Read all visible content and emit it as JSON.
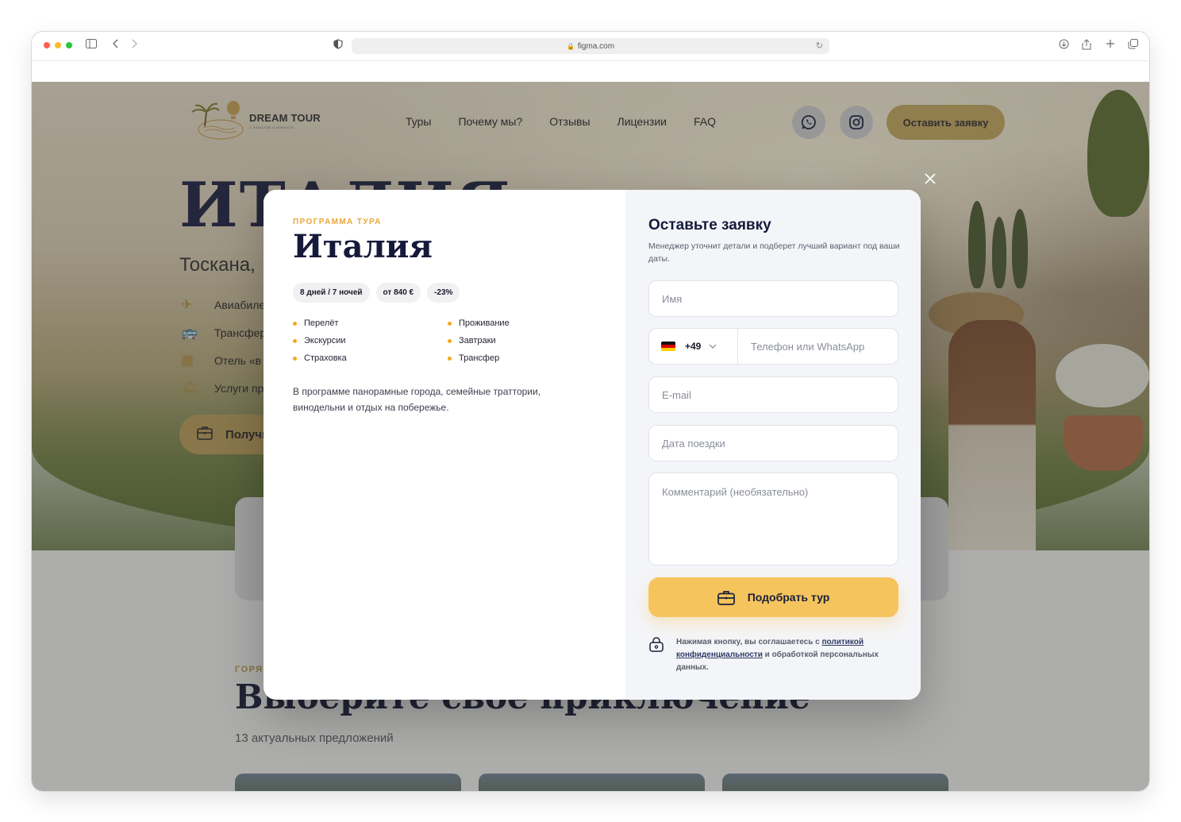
{
  "browser": {
    "url": "figma.com"
  },
  "nav": {
    "logo_text": "DREAM TOUR",
    "logo_sub": "С ЗАБОТОЙ О КЛИЕНТЕ",
    "links": [
      "Туры",
      "Почему мы?",
      "Отзывы",
      "Лицензии",
      "FAQ"
    ],
    "cta": "Оставить заявку"
  },
  "hero": {
    "title": "ИТАЛИЯ",
    "subtitle": "Тоскана,",
    "features": [
      "Авиабиле",
      "Трансфер",
      "Отель «в",
      "Услуги пр"
    ],
    "button": "Получи"
  },
  "section": {
    "eyebrow": "ГОРЯ",
    "title": "Выберите свое приключение",
    "subtitle": "13 актуальных предложений"
  },
  "modal": {
    "eyebrow": "ПРОГРАММА ТУРА",
    "title": "Италия",
    "chips": [
      "8 дней / 7 ночей",
      "от 840 €",
      "-23%"
    ],
    "included_left": [
      "Перелёт",
      "Экскурсии",
      "Страховка"
    ],
    "included_right": [
      "Проживание",
      "Завтраки",
      "Трансфер"
    ],
    "description": "В программе панорамные города, семейные траттории, винодельни и отдых на побережье.",
    "form": {
      "title": "Оставьте заявку",
      "subtitle": "Менеджер уточнит детали и подберет лучший вариант под ваши даты.",
      "name_placeholder": "Имя",
      "country_code": "+49",
      "phone_placeholder": "Телефон или WhatsApp",
      "email_placeholder": "E-mail",
      "date_placeholder": "Дата поездки",
      "comment_placeholder": "Комментарий (необязательно)",
      "submit": "Подобрать тур",
      "consent_prefix": "Нажимая кнопку, вы соглашаетесь с",
      "consent_link": "политикой конфиденциальности",
      "consent_suffix": "и обработкой персональных данных."
    }
  },
  "colors": {
    "accent": "#f5c45d",
    "eyebrow": "#e8a83a",
    "navy": "#151a3a"
  }
}
